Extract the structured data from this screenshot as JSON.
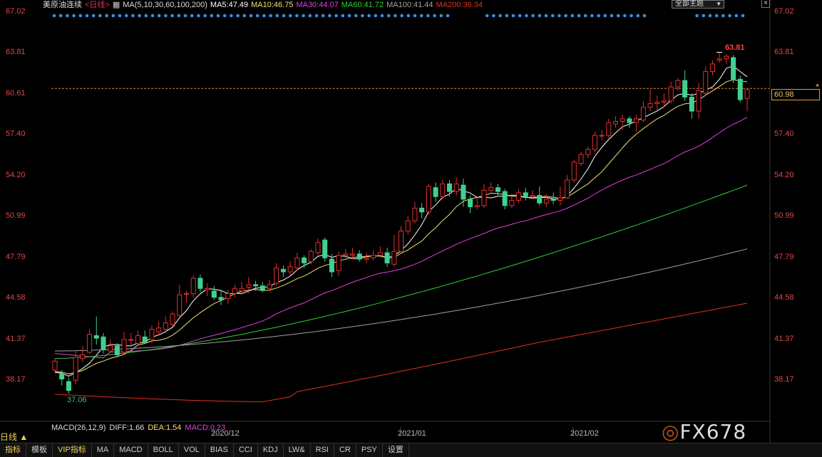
{
  "header": {
    "symbol": "美原油连续",
    "period_tag": "<日线>",
    "ma_label": "MA(5,10,30,60,100,200)",
    "ma5": "MA5:47.49",
    "ma10": "MA10:46.75",
    "ma30": "MA30:44.07",
    "ma60": "MA60:41.72",
    "ma100": "MA100:41.44",
    "ma200": "MA200:36.34",
    "theme_button": "全部主题",
    "close": "×"
  },
  "colors": {
    "up": "#e03030",
    "down": "#40d090",
    "ma5": "#ffffff",
    "ma10": "#f0e070",
    "ma30": "#e040e0",
    "ma60": "#30d030",
    "ma100": "#a0a0a0",
    "ma200": "#e03020"
  },
  "left_axis": [
    "67.02",
    "63.81",
    "60.61",
    "57.40",
    "54.20",
    "50.99",
    "47.79",
    "44.58",
    "41.37",
    "38.17"
  ],
  "right_axis": [
    "67.02",
    "63.81",
    "60.61",
    "57.40",
    "54.20",
    "50.99",
    "47.79",
    "44.58",
    "41.37",
    "38.17"
  ],
  "current_price": "60.98",
  "high_label": "63.81",
  "low_label": "37.06",
  "period_label": "日线 ▲",
  "macd": {
    "label": "MACD(26,12,9)",
    "diff": "DIFF:1.66",
    "dea": "DEA:1.54",
    "macd": "MACD:0.23"
  },
  "dates": [
    "2020/12",
    "2021/01",
    "2021/02"
  ],
  "watermark": "FX678",
  "tabs": [
    "指标",
    "模板",
    "VIP指标",
    "MA",
    "MACD",
    "BOLL",
    "VOL",
    "BIAS",
    "CCI",
    "KDJ",
    "LW&",
    "RSI",
    "CR",
    "PSY",
    "设置"
  ],
  "chart_data": {
    "type": "candlestick",
    "ylim": [
      36.5,
      67.5
    ],
    "candles": [
      [
        38.9,
        39.6,
        39.8,
        38.8
      ],
      [
        38.6,
        38.2,
        38.9,
        37.7
      ],
      [
        38.0,
        37.3,
        38.3,
        37.06
      ],
      [
        38.1,
        39.9,
        40.5,
        37.8
      ],
      [
        39.8,
        40.1,
        40.8,
        39.5
      ],
      [
        40.3,
        41.7,
        42.1,
        40.2
      ],
      [
        41.6,
        41.4,
        43.1,
        40.9
      ],
      [
        41.5,
        40.5,
        41.8,
        40.2
      ],
      [
        40.4,
        40.8,
        41.3,
        40.2
      ],
      [
        40.8,
        40.1,
        41.0,
        39.9
      ],
      [
        40.3,
        41.3,
        41.9,
        40.2
      ],
      [
        41.3,
        41.3,
        41.8,
        40.8
      ],
      [
        41.0,
        41.6,
        42.0,
        40.9
      ],
      [
        41.5,
        41.1,
        42.0,
        41.0
      ],
      [
        41.3,
        42.1,
        42.4,
        41.0
      ],
      [
        41.9,
        42.2,
        42.7,
        41.6
      ],
      [
        42.1,
        42.6,
        43.1,
        41.8
      ],
      [
        42.5,
        43.3,
        43.5,
        42.3
      ],
      [
        43.2,
        44.8,
        45.6,
        43.0
      ],
      [
        44.9,
        44.9,
        45.1,
        44.2
      ],
      [
        44.9,
        46.1,
        46.3,
        44.6
      ],
      [
        46.1,
        45.3,
        46.4,
        45.0
      ],
      [
        45.2,
        45.3,
        45.7,
        44.7
      ],
      [
        45.1,
        44.6,
        45.5,
        44.4
      ],
      [
        44.6,
        44.4,
        45.1,
        44.0
      ],
      [
        44.5,
        44.9,
        45.2,
        44.1
      ],
      [
        44.9,
        45.3,
        45.6,
        44.6
      ],
      [
        45.1,
        45.3,
        45.8,
        44.8
      ],
      [
        45.4,
        45.6,
        46.2,
        44.9
      ],
      [
        45.6,
        45.5,
        45.9,
        45.1
      ],
      [
        45.5,
        45.2,
        45.8,
        45.0
      ],
      [
        45.3,
        45.6,
        46.0,
        45.0
      ],
      [
        45.7,
        46.9,
        47.3,
        45.5
      ],
      [
        46.8,
        46.6,
        47.1,
        46.2
      ],
      [
        46.6,
        47.0,
        47.4,
        46.3
      ],
      [
        46.9,
        47.7,
        48.1,
        46.7
      ],
      [
        47.7,
        47.3,
        47.9,
        46.9
      ],
      [
        47.4,
        48.2,
        48.4,
        47.2
      ],
      [
        48.1,
        48.9,
        49.2,
        47.9
      ],
      [
        49.1,
        47.7,
        49.3,
        47.4
      ],
      [
        47.6,
        46.6,
        48.0,
        46.2
      ],
      [
        46.7,
        47.9,
        48.2,
        46.3
      ],
      [
        47.9,
        48.0,
        48.4,
        47.5
      ],
      [
        47.9,
        48.0,
        48.5,
        47.6
      ],
      [
        48.0,
        47.6,
        48.3,
        47.4
      ],
      [
        47.6,
        47.7,
        48.1,
        47.3
      ],
      [
        47.7,
        47.9,
        48.3,
        47.5
      ],
      [
        47.9,
        48.1,
        48.6,
        47.7
      ],
      [
        48.1,
        47.3,
        48.5,
        47.0
      ],
      [
        47.2,
        48.2,
        49.5,
        47.0
      ],
      [
        48.2,
        49.8,
        50.2,
        48.0
      ],
      [
        49.8,
        50.6,
        51.0,
        49.5
      ],
      [
        50.6,
        51.6,
        52.1,
        50.4
      ],
      [
        51.6,
        51.3,
        52.0,
        50.8
      ],
      [
        51.3,
        53.3,
        53.5,
        51.1
      ],
      [
        53.2,
        52.5,
        53.6,
        52.1
      ],
      [
        52.5,
        53.5,
        53.8,
        52.3
      ],
      [
        53.5,
        52.9,
        53.8,
        52.5
      ],
      [
        52.9,
        53.5,
        54.0,
        52.6
      ],
      [
        53.4,
        52.3,
        53.9,
        51.7
      ],
      [
        52.3,
        51.7,
        52.6,
        51.2
      ],
      [
        51.7,
        51.8,
        52.4,
        51.5
      ],
      [
        51.8,
        53.0,
        53.5,
        51.6
      ],
      [
        53.0,
        53.2,
        53.6,
        52.7
      ],
      [
        53.2,
        52.9,
        53.5,
        52.5
      ],
      [
        52.9,
        51.8,
        53.1,
        51.5
      ],
      [
        51.8,
        52.2,
        52.6,
        51.6
      ],
      [
        52.2,
        52.8,
        53.1,
        52.0
      ],
      [
        52.8,
        52.5,
        53.2,
        52.2
      ],
      [
        52.5,
        52.6,
        53.0,
        52.3
      ],
      [
        52.6,
        52.0,
        53.3,
        51.8
      ],
      [
        52.0,
        52.3,
        52.7,
        51.7
      ],
      [
        52.3,
        52.2,
        52.8,
        51.9
      ],
      [
        52.2,
        52.4,
        53.3,
        51.8
      ],
      [
        52.4,
        53.8,
        54.2,
        52.3
      ],
      [
        53.8,
        55.2,
        55.4,
        53.6
      ],
      [
        55.1,
        55.8,
        56.0,
        54.9
      ],
      [
        55.8,
        56.2,
        56.4,
        55.5
      ],
      [
        56.2,
        57.3,
        57.6,
        56.0
      ],
      [
        57.3,
        57.3,
        57.7,
        56.9
      ],
      [
        57.3,
        58.3,
        58.6,
        57.1
      ],
      [
        58.2,
        58.4,
        58.8,
        57.9
      ],
      [
        58.4,
        58.6,
        58.9,
        57.7
      ],
      [
        58.6,
        58.3,
        58.8,
        57.9
      ],
      [
        58.3,
        58.6,
        58.9,
        57.6
      ],
      [
        58.5,
        59.5,
        60.0,
        58.3
      ],
      [
        59.5,
        59.8,
        60.9,
        59.2
      ],
      [
        59.8,
        59.9,
        60.4,
        59.3
      ],
      [
        59.9,
        60.0,
        60.6,
        59.5
      ],
      [
        60.0,
        61.1,
        61.5,
        59.8
      ],
      [
        61.1,
        61.6,
        61.8,
        60.8
      ],
      [
        61.6,
        60.3,
        62.4,
        60.0
      ],
      [
        60.3,
        59.2,
        60.6,
        58.6
      ],
      [
        59.2,
        60.8,
        61.4,
        58.6
      ],
      [
        60.6,
        62.3,
        62.7,
        60.4
      ],
      [
        62.3,
        62.9,
        63.2,
        62.0
      ],
      [
        63.2,
        63.3,
        63.81,
        63.0
      ],
      [
        63.3,
        63.5,
        63.7,
        62.9
      ],
      [
        63.4,
        61.7,
        63.6,
        61.4
      ],
      [
        61.7,
        60.1,
        62.0,
        59.9
      ],
      [
        60.2,
        60.9,
        61.0,
        59.2
      ]
    ]
  }
}
